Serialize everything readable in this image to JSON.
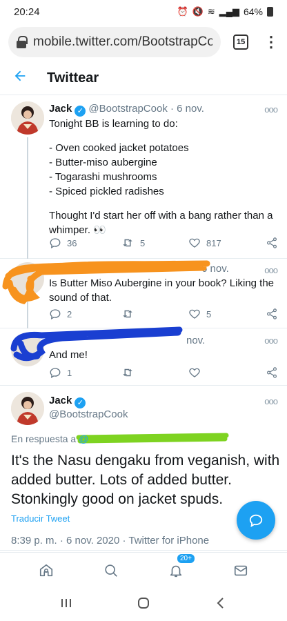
{
  "status_bar": {
    "time": "20:24",
    "battery": "64%"
  },
  "browser": {
    "url": "mobile.twitter.com/BootstrapCook",
    "tab_count": "15"
  },
  "header": {
    "title": "Twittear"
  },
  "tweets": [
    {
      "name": "Jack",
      "handle": "@BootstrapCook",
      "date": "· 6 nov.",
      "text_lines": [
        "Tonight BB is learning to do:",
        "",
        "- Oven cooked jacket potatoes",
        "- Butter-miso aubergine",
        "- Togarashi mushrooms",
        "- Spiced pickled radishes",
        "",
        "Thought I'd start her off with a bang rather than a whimper. 👀"
      ],
      "replies": "36",
      "retweets": "5",
      "likes": "817"
    },
    {
      "date": "6 nov.",
      "text": "Is Butter Miso Aubergine in your book? Liking the sound of that.",
      "replies": "2",
      "retweets": "",
      "likes": "5"
    },
    {
      "date": "nov.",
      "text": "And me!",
      "replies": "1",
      "retweets": "",
      "likes": ""
    }
  ],
  "main_tweet": {
    "name": "Jack",
    "handle": "@BootstrapCook",
    "reply_label": "En respuesta a",
    "text": "It's the Nasu dengaku from veganish, with added butter. Lots of added butter. Stonkingly good on jacket spuds.",
    "translate": "Traducir Tweet",
    "meta": "8:39 p. m. · 6 nov. 2020 · Twitter for iPhone"
  },
  "bottom_nav": {
    "notifications_badge": "20+"
  },
  "colors": {
    "accent": "#1da1f2",
    "orange_scribble": "#f7931e",
    "blue_scribble": "#1a3fd1",
    "green_scribble": "#7ed321"
  },
  "icons": [
    "lock-icon",
    "back-arrow-icon",
    "verified-icon",
    "more-icon",
    "reply-icon",
    "retweet-icon",
    "like-icon",
    "share-icon",
    "compose-icon",
    "home-icon",
    "search-icon",
    "bell-icon",
    "mail-icon"
  ]
}
